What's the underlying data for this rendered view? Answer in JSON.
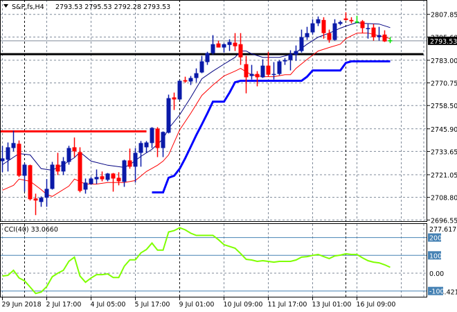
{
  "header": {
    "menu_icon": "triangle-down-icon",
    "symbol": "S&P,fs,H4",
    "ohlc": "2793.53 2795.53 2792.28 2793.53"
  },
  "colors": {
    "bull": "#0a1aa8",
    "bear": "#ff0000",
    "doji": "#00e000",
    "ma_fast": "#000080",
    "ma_slow": "#ff0000",
    "step_line": "#0000ff",
    "cci": "#7fff00",
    "cci_levels": "#4682b4",
    "grid": "#7f8a99"
  },
  "chart_data": [
    {
      "type": "candlestick",
      "title": "S&P,fs,H4",
      "ylim": [
        2696.55,
        2807.85
      ],
      "y_ticks": [
        "2807.85",
        "2795.60",
        "2783.00",
        "2770.75",
        "2758.50",
        "2745.90",
        "2733.65",
        "2721.05",
        "2708.80",
        "2696.55"
      ],
      "current_price_label": "2793.53",
      "x_tick_labels": [
        {
          "candle": 1,
          "label": "29 Jun 2018"
        },
        {
          "candle": 9,
          "label": "2 Jul 17:00"
        },
        {
          "candle": 17,
          "label": "4 Jul 05:00"
        },
        {
          "candle": 25,
          "label": "5 Jul 17:00"
        },
        {
          "candle": 33,
          "label": "9 Jul 01:00"
        },
        {
          "candle": 41,
          "label": "10 Jul 09:00"
        },
        {
          "candle": 49,
          "label": "11 Jul 17:00"
        },
        {
          "candle": 57,
          "label": "13 Jul 01:00"
        },
        {
          "candle": 65,
          "label": "16 Jul 09:00"
        }
      ],
      "period_separators": [
        5,
        33,
        63
      ],
      "ohlc": [
        [
          2728.4,
          2736.7,
          2722.4,
          2729.9
        ],
        [
          2729.2,
          2738.5,
          2722.8,
          2735.9
        ],
        [
          2735.5,
          2744.9,
          2733.7,
          2738.2
        ],
        [
          2737.8,
          2739.6,
          2719.8,
          2720.5
        ],
        [
          2720.5,
          2727.3,
          2711.9,
          2726.5
        ],
        [
          2726.2,
          2726.5,
          2707.1,
          2707.8
        ],
        [
          2708.2,
          2710.8,
          2699.2,
          2707.1
        ],
        [
          2706.3,
          2709.3,
          2703.7,
          2708.6
        ],
        [
          2708.6,
          2718.7,
          2703.7,
          2713.4
        ],
        [
          2713.4,
          2728.0,
          2713.0,
          2726.5
        ],
        [
          2726.5,
          2732.9,
          2720.9,
          2722.8
        ],
        [
          2722.8,
          2730.6,
          2720.9,
          2728.4
        ],
        [
          2728.0,
          2736.7,
          2726.5,
          2735.5
        ],
        [
          2735.9,
          2741.2,
          2730.6,
          2733.7
        ],
        [
          2733.3,
          2735.9,
          2711.5,
          2712.3
        ],
        [
          2713.0,
          2719.0,
          2710.8,
          2716.8
        ],
        [
          2716.0,
          2719.8,
          2715.7,
          2719.0
        ],
        [
          2718.6,
          2723.9,
          2716.0,
          2719.8
        ],
        [
          2720.2,
          2722.8,
          2717.5,
          2718.6
        ],
        [
          2718.3,
          2722.0,
          2717.5,
          2721.7
        ],
        [
          2721.7,
          2722.0,
          2711.9,
          2719.0
        ],
        [
          2719.4,
          2722.4,
          2715.3,
          2717.5
        ],
        [
          2717.2,
          2729.2,
          2714.5,
          2728.8
        ],
        [
          2728.8,
          2735.2,
          2724.3,
          2725.4
        ],
        [
          2725.4,
          2735.5,
          2716.8,
          2732.9
        ],
        [
          2732.9,
          2739.3,
          2725.4,
          2738.2
        ],
        [
          2735.9,
          2739.3,
          2732.9,
          2738.5
        ],
        [
          2738.2,
          2746.8,
          2735.5,
          2746.4
        ],
        [
          2746.0,
          2746.8,
          2730.6,
          2735.5
        ],
        [
          2735.5,
          2744.5,
          2730.6,
          2744.2
        ],
        [
          2743.8,
          2764.4,
          2743.4,
          2762.5
        ],
        [
          2762.9,
          2765.5,
          2756.1,
          2761.8
        ],
        [
          2761.8,
          2772.2,
          2761.4,
          2771.9
        ],
        [
          2772.2,
          2774.1,
          2770.8,
          2771.5
        ],
        [
          2771.5,
          2774.5,
          2769.6,
          2773.4
        ],
        [
          2773.4,
          2778.6,
          2771.1,
          2776.0
        ],
        [
          2776.4,
          2785.4,
          2776.0,
          2782.4
        ],
        [
          2782.0,
          2787.6,
          2780.5,
          2786.9
        ],
        [
          2786.9,
          2796.6,
          2786.1,
          2791.7
        ],
        [
          2792.1,
          2793.6,
          2789.9,
          2789.9
        ],
        [
          2789.9,
          2792.1,
          2787.2,
          2791.7
        ],
        [
          2791.3,
          2794.4,
          2788.0,
          2792.9
        ],
        [
          2792.5,
          2797.7,
          2788.0,
          2790.6
        ],
        [
          2791.7,
          2797.7,
          2780.5,
          2784.6
        ],
        [
          2780.9,
          2785.4,
          2765.1,
          2773.8
        ],
        [
          2774.5,
          2780.5,
          2772.6,
          2775.6
        ],
        [
          2775.6,
          2777.1,
          2768.9,
          2773.8
        ],
        [
          2773.8,
          2783.5,
          2773.4,
          2780.1
        ],
        [
          2780.1,
          2787.6,
          2774.1,
          2775.2
        ],
        [
          2775.2,
          2782.0,
          2772.6,
          2775.6
        ],
        [
          2775.6,
          2783.1,
          2774.9,
          2782.4
        ],
        [
          2782.4,
          2784.2,
          2780.5,
          2783.1
        ],
        [
          2783.1,
          2788.4,
          2777.5,
          2786.1
        ],
        [
          2786.1,
          2791.0,
          2782.7,
          2788.0
        ],
        [
          2788.0,
          2799.6,
          2787.2,
          2795.5
        ],
        [
          2795.5,
          2801.1,
          2794.0,
          2797.7
        ],
        [
          2798.1,
          2805.2,
          2797.0,
          2803.0
        ],
        [
          2803.0,
          2806.7,
          2801.5,
          2805.2
        ],
        [
          2804.8,
          2806.3,
          2794.7,
          2797.7
        ],
        [
          2797.7,
          2799.6,
          2792.5,
          2794.0
        ],
        [
          2794.0,
          2805.2,
          2793.6,
          2803.0
        ],
        [
          2802.7,
          2804.5,
          2801.9,
          2803.7
        ],
        [
          2805.6,
          2809.0,
          2804.5,
          2804.8
        ],
        [
          2804.8,
          2806.3,
          2803.0,
          2804.1
        ],
        [
          2803.7,
          2807.1,
          2803.0,
          2803.7
        ],
        [
          2804.1,
          2804.8,
          2797.7,
          2800.4
        ],
        [
          2800.0,
          2802.6,
          2794.7,
          2800.4
        ],
        [
          2800.7,
          2802.6,
          2793.6,
          2795.5
        ],
        [
          2795.5,
          2801.1,
          2793.6,
          2796.6
        ],
        [
          2796.9,
          2799.2,
          2792.9,
          2793.2
        ],
        [
          2793.53,
          2795.53,
          2792.28,
          2793.53
        ]
      ],
      "ma_fast": [
        [
          1,
          2726.5
        ],
        [
          4,
          2732.5
        ],
        [
          6,
          2731.8
        ],
        [
          8,
          2724.3
        ],
        [
          10,
          2723.5
        ],
        [
          12,
          2726.5
        ],
        [
          14,
          2730.3
        ],
        [
          15,
          2733.3
        ],
        [
          17,
          2728.4
        ],
        [
          20,
          2726.2
        ],
        [
          23,
          2725.0
        ],
        [
          24,
          2726.5
        ],
        [
          26,
          2731.0
        ],
        [
          28,
          2734.8
        ],
        [
          30,
          2740.4
        ],
        [
          31,
          2746.0
        ],
        [
          33,
          2753.5
        ],
        [
          35,
          2762.9
        ],
        [
          37,
          2773.0
        ],
        [
          39,
          2777.1
        ],
        [
          41,
          2780.9
        ],
        [
          43,
          2784.6
        ],
        [
          44,
          2788.0
        ],
        [
          45,
          2788.0
        ],
        [
          46,
          2786.5
        ],
        [
          48,
          2784.6
        ],
        [
          51,
          2784.6
        ],
        [
          53,
          2786.1
        ],
        [
          54,
          2787.2
        ],
        [
          56,
          2791.7
        ],
        [
          58,
          2795.5
        ],
        [
          60,
          2797.7
        ],
        [
          62,
          2800.4
        ],
        [
          63,
          2801.5
        ],
        [
          65,
          2803.4
        ],
        [
          66,
          2803.0
        ],
        [
          69,
          2802.6
        ],
        [
          71,
          2800.7
        ]
      ],
      "ma_slow": [
        [
          1,
          2712.7
        ],
        [
          3,
          2715.3
        ],
        [
          4,
          2718.7
        ],
        [
          6,
          2717.5
        ],
        [
          8,
          2713.0
        ],
        [
          9,
          2710.4
        ],
        [
          10,
          2709.3
        ],
        [
          13,
          2714.9
        ],
        [
          14,
          2718.7
        ],
        [
          16,
          2716.0
        ],
        [
          18,
          2716.0
        ],
        [
          20,
          2716.8
        ],
        [
          23,
          2716.8
        ],
        [
          25,
          2717.9
        ],
        [
          27,
          2722.8
        ],
        [
          29,
          2726.2
        ],
        [
          30,
          2728.4
        ],
        [
          31,
          2731.8
        ],
        [
          33,
          2745.3
        ],
        [
          35,
          2754.3
        ],
        [
          37,
          2764.0
        ],
        [
          39,
          2769.6
        ],
        [
          41,
          2774.5
        ],
        [
          43,
          2777.1
        ],
        [
          44,
          2778.6
        ],
        [
          45,
          2776.7
        ],
        [
          46,
          2775.2
        ],
        [
          48,
          2774.1
        ],
        [
          50,
          2774.1
        ],
        [
          52,
          2775.2
        ],
        [
          53,
          2775.2
        ],
        [
          54,
          2778.6
        ],
        [
          56,
          2783.5
        ],
        [
          58,
          2788.0
        ],
        [
          60,
          2789.9
        ],
        [
          62,
          2791.7
        ],
        [
          63,
          2794.7
        ],
        [
          65,
          2797.7
        ],
        [
          67,
          2797.7
        ],
        [
          69,
          2796.2
        ],
        [
          71,
          2794.7
        ]
      ],
      "step_line": [
        [
          28,
          2711.5
        ],
        [
          29,
          2711.5
        ],
        [
          30,
          2711.5
        ],
        [
          31,
          2719.4
        ],
        [
          32,
          2720.5
        ],
        [
          33,
          2724.3
        ],
        [
          34,
          2730.0
        ],
        [
          35,
          2736.2
        ],
        [
          36,
          2742.5
        ],
        [
          37,
          2748.3
        ],
        [
          38,
          2754.3
        ],
        [
          39,
          2760.6
        ],
        [
          40,
          2760.6
        ],
        [
          41,
          2760.6
        ],
        [
          42,
          2765.5
        ],
        [
          43,
          2771.1
        ],
        [
          44,
          2771.9
        ],
        [
          55,
          2771.9
        ],
        [
          56,
          2774.1
        ],
        [
          57,
          2777.5
        ],
        [
          62,
          2777.5
        ],
        [
          63,
          2781.6
        ],
        [
          64,
          2782.4
        ],
        [
          71,
          2782.4
        ]
      ],
      "horizontal_lines": [
        {
          "name": "resistance",
          "price": 2786.3,
          "color": "#000000",
          "from_candle": 0,
          "to_candle": 77
        },
        {
          "name": "support-old",
          "price": 2744.5,
          "color": "#ff0000",
          "from_candle": 0,
          "to_candle": 27
        }
      ]
    },
    {
      "type": "line",
      "title": "CCI(40) 33.0660",
      "ylim": [
        -153.4215,
        277.617
      ],
      "levels": [
        200,
        100,
        -100
      ],
      "y_labels": {
        "top": "277.617",
        "l200": "200",
        "l100": "100",
        "zero": "0.00",
        "lm100": "-100",
        "bottom": "-153.4215"
      },
      "values": [
        -16,
        -12,
        16,
        -27,
        -43,
        -78,
        -114,
        -106,
        -75,
        -20,
        0,
        16,
        67,
        90,
        -16,
        -51,
        -27,
        -8,
        -8,
        -4,
        -24,
        -24,
        39,
        75,
        75,
        114,
        133,
        169,
        129,
        129,
        231,
        239,
        255,
        243,
        224,
        212,
        212,
        212,
        212,
        188,
        160,
        150,
        140,
        110,
        78,
        74,
        66,
        70,
        66,
        62,
        66,
        66,
        66,
        74,
        90,
        93,
        100,
        105,
        93,
        82,
        97,
        101,
        109,
        105,
        105,
        86,
        70,
        62,
        58,
        47,
        33.066
      ]
    }
  ]
}
